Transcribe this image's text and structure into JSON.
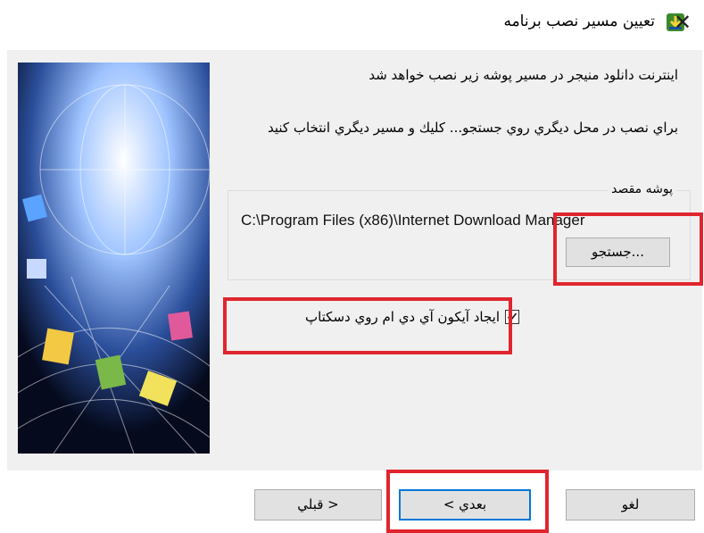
{
  "window": {
    "title": "تعيين مسير نصب برنامه",
    "close_glyph": "✕"
  },
  "content": {
    "intro_text": "اينترنت دانلود منيجر در مسير پوشه زير نصب خواهد شد",
    "browse_hint": "براي نصب در محل ديگري روي جستجو... كليك و مسير ديگري انتخاب كنيد"
  },
  "destination": {
    "legend": "پوشه مقصد",
    "path": "C:\\Program Files (x86)\\Internet Download Manager",
    "browse_label": "جستجو..."
  },
  "options": {
    "desktop_icon_label": "ايجاد آيكون آي دي ام روي دسكتاپ",
    "desktop_icon_checked": true
  },
  "buttons": {
    "back_label": "قبلي >",
    "next_label": "< بعدي",
    "cancel_label": "لغو"
  },
  "colors": {
    "highlight": "#e0252f",
    "focus": "#0078d7"
  }
}
